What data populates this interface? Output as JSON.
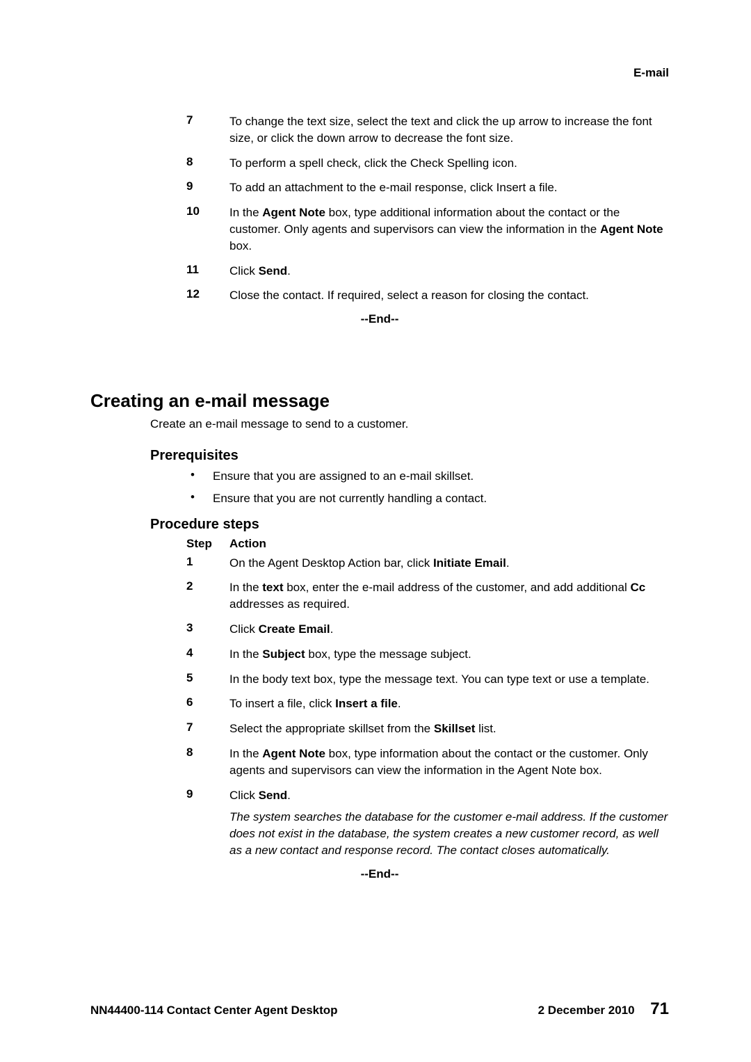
{
  "header": {
    "label": "E-mail"
  },
  "continued_steps": {
    "items": [
      {
        "num": "7",
        "html": "To change the text size, select the text and click the up arrow to increase the font size, or click the down arrow to decrease the font size."
      },
      {
        "num": "8",
        "html": "To perform a spell check, click the Check Spelling icon."
      },
      {
        "num": "9",
        "html": "To add an attachment to the e-mail response, click Insert a file."
      },
      {
        "num": "10",
        "html": "In the <span class=\"b\">Agent Note</span> box, type additional information about the contact or the customer. Only agents and supervisors can view the information in the <span class=\"b\">Agent Note</span> box."
      },
      {
        "num": "11",
        "html": "Click <span class=\"b\">Send</span>."
      },
      {
        "num": "12",
        "html": "Close the contact. If required, select a reason for closing the contact."
      }
    ],
    "end": "--End--"
  },
  "section": {
    "title": "Creating an e-mail message",
    "intro": "Create an e-mail message to send to a customer.",
    "prereq_title": "Prerequisites",
    "prereqs": [
      "Ensure that you are assigned to an e-mail skillset.",
      "Ensure that you are not currently handling a contact."
    ],
    "procedure_title": "Procedure steps",
    "step_header_step": "Step",
    "step_header_action": "Action",
    "steps": [
      {
        "num": "1",
        "html": "On the Agent Desktop Action bar, click <span class=\"b\">Initiate Email</span>."
      },
      {
        "num": "2",
        "html": "In the <span class=\"b\">text</span> box, enter the e-mail address of the customer, and add additional <span class=\"b\">Cc</span> addresses as required."
      },
      {
        "num": "3",
        "html": "Click <span class=\"b\">Create Email</span>."
      },
      {
        "num": "4",
        "html": "In the <span class=\"b\">Subject</span> box, type the message subject."
      },
      {
        "num": "5",
        "html": "In the body text box, type the message text. You can type text or use a template."
      },
      {
        "num": "6",
        "html": "To insert a file, click <span class=\"b\">Insert a file</span>."
      },
      {
        "num": "7",
        "html": "Select the appropriate skillset from the <span class=\"b\">Skillset</span> list."
      },
      {
        "num": "8",
        "html": "In the <span class=\"b\">Agent Note</span> box, type information about the contact or the customer. Only agents and supervisors can view the information in the Agent Note box."
      },
      {
        "num": "9",
        "html": "Click <span class=\"b\">Send</span>.<div class=\"italic-note\">The system searches the database for the customer e-mail address. If the customer does not exist in the database, the system creates a new customer record, as well as a new contact and response record. The contact closes automatically.</div>"
      }
    ],
    "end": "--End--"
  },
  "footer": {
    "left": "NN44400-114 Contact Center Agent Desktop",
    "date": "2 December 2010",
    "page": "71"
  }
}
